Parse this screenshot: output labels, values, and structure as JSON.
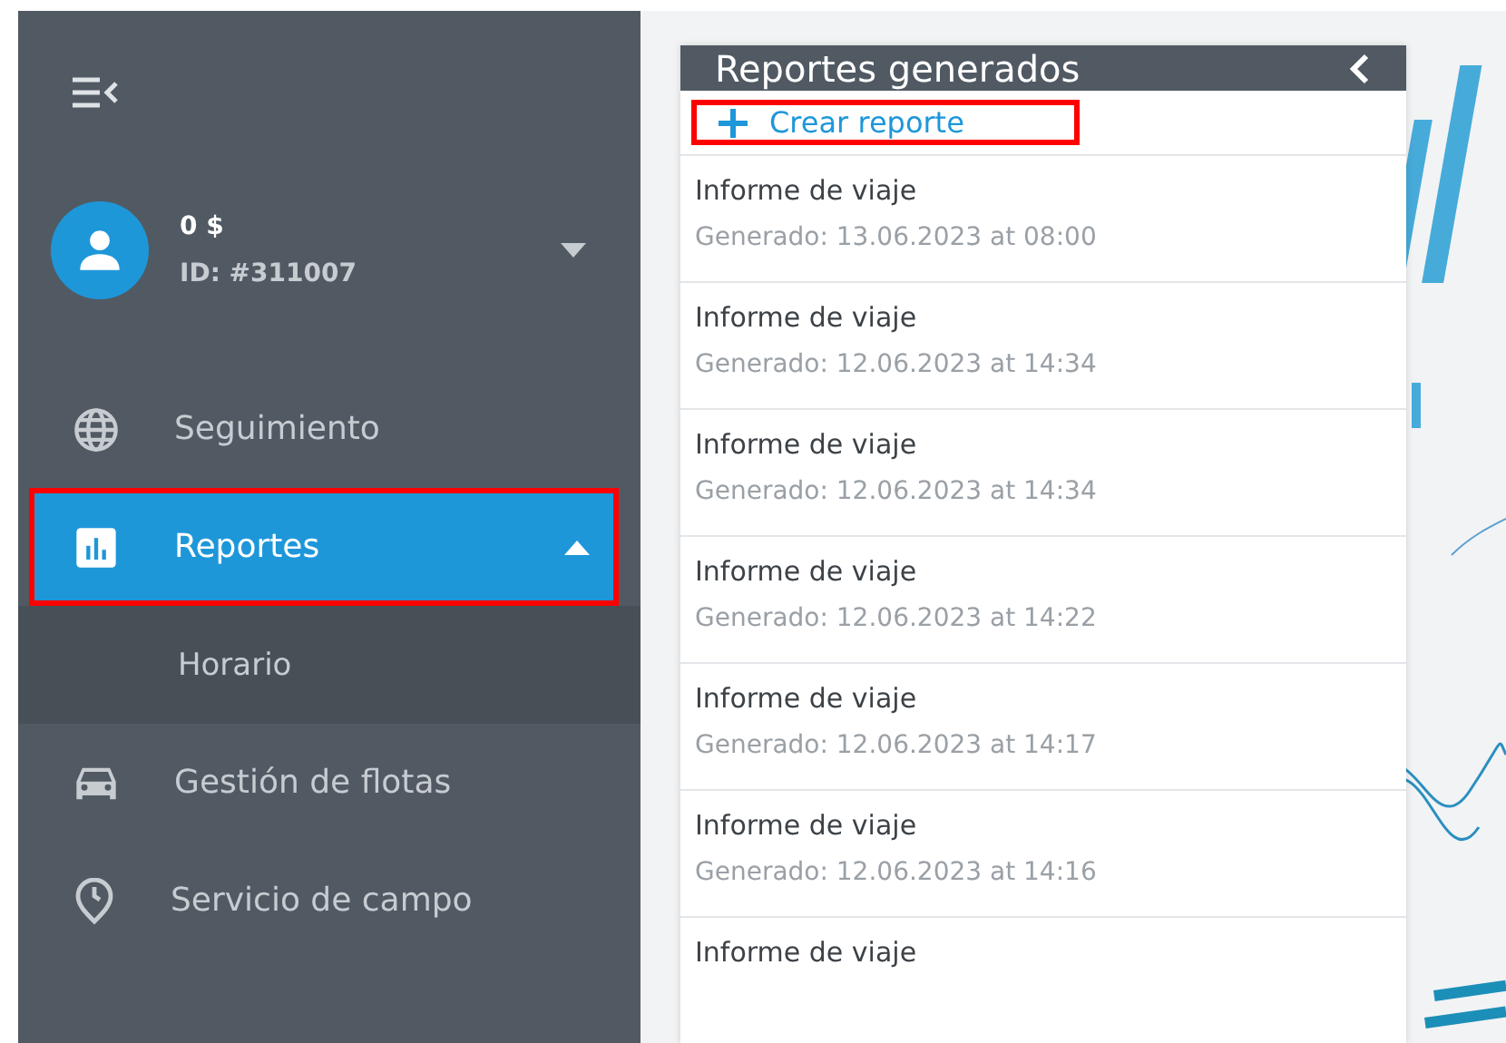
{
  "sidebar": {
    "user": {
      "balance": "0 $",
      "id": "ID: #311007"
    },
    "items": [
      {
        "label": "Seguimiento",
        "kind": "globe",
        "selected": false,
        "highlighted": false
      },
      {
        "label": "Reportes",
        "kind": "chart",
        "selected": true,
        "expanded": true,
        "highlighted": true,
        "children": [
          {
            "label": "Horario"
          }
        ]
      },
      {
        "label": "Gestión de flotas",
        "kind": "car",
        "selected": false,
        "highlighted": false
      },
      {
        "label": "Servicio de campo",
        "kind": "clock",
        "selected": false,
        "highlighted": false
      }
    ]
  },
  "panel": {
    "title": "Reportes generados",
    "create": {
      "label": "Crear reporte",
      "highlighted": true
    },
    "reports": [
      {
        "name": "Informe de viaje",
        "generated": "Generado: 13.06.2023 at 08:00"
      },
      {
        "name": "Informe de viaje",
        "generated": "Generado: 12.06.2023 at 14:34"
      },
      {
        "name": "Informe de viaje",
        "generated": "Generado: 12.06.2023 at 14:34"
      },
      {
        "name": "Informe de viaje",
        "generated": "Generado: 12.06.2023 at 14:22"
      },
      {
        "name": "Informe de viaje",
        "generated": "Generado: 12.06.2023 at 14:17"
      },
      {
        "name": "Informe de viaje",
        "generated": "Generado: 12.06.2023 at 14:16"
      },
      {
        "name": "Informe de viaje"
      }
    ]
  }
}
